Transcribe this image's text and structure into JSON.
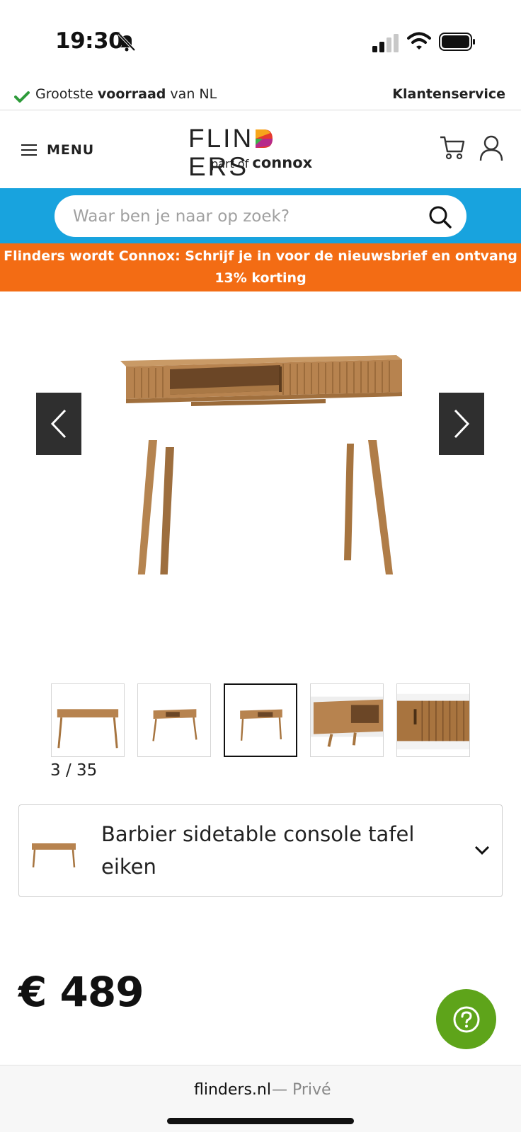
{
  "status_bar": {
    "time": "19:30"
  },
  "promo_line": {
    "text_prefix": "Grootste ",
    "text_bold": "voorraad",
    "text_suffix": " van NL",
    "service_link": "Klantenservice",
    "check_color": "#2e9b3a"
  },
  "header": {
    "menu_label": "MENU",
    "logo_prefix": "FLIN",
    "logo_suffix": "ERS",
    "logo_sub_part": "part of",
    "logo_sub_brand": "connox"
  },
  "search": {
    "placeholder": "Waar ben je naar op zoek?",
    "band_color": "#18a3de"
  },
  "newsletter": {
    "line1": "Flinders wordt Connox: Schrijf je in voor de nieuwsbrief en ontvang",
    "line2": "13% korting",
    "color": "#f36c14"
  },
  "gallery": {
    "counter": "3 / 35",
    "thumbnails": [
      {
        "icon": "console-front-thumb"
      },
      {
        "icon": "console-angle-thumb"
      },
      {
        "icon": "console-open-thumb",
        "active": true
      },
      {
        "icon": "console-detail-thumb"
      },
      {
        "icon": "console-closeup-thumb"
      }
    ]
  },
  "product": {
    "name": "Barbier sidetable console tafel eiken",
    "price": "€ 489"
  },
  "help": {
    "color": "#5ea41a"
  },
  "browser": {
    "domain": "flinders.nl",
    "private_label": "— Privé"
  }
}
